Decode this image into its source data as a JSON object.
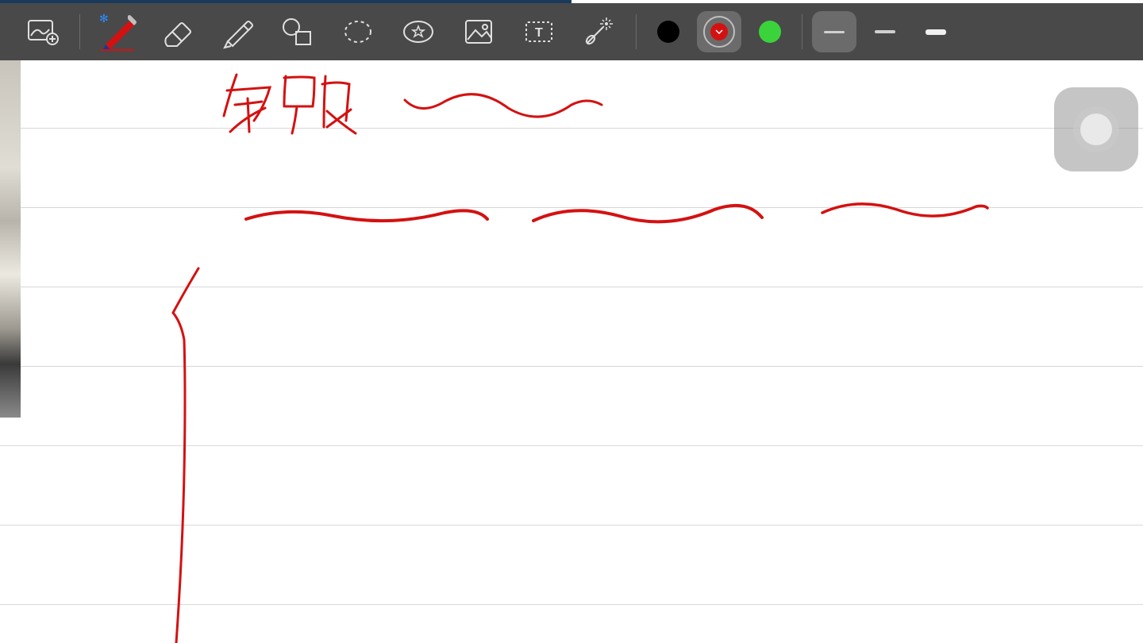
{
  "toolbar": {
    "tools": [
      {
        "name": "insert-image-icon"
      },
      {
        "name": "pen-icon",
        "active": true
      },
      {
        "name": "eraser-icon"
      },
      {
        "name": "highlighter-icon"
      },
      {
        "name": "shape-tool-icon"
      },
      {
        "name": "lasso-icon"
      },
      {
        "name": "favorite-tool-icon"
      },
      {
        "name": "image-icon"
      },
      {
        "name": "text-box-icon"
      },
      {
        "name": "laser-pointer-icon"
      }
    ],
    "colors": {
      "black": "#000000",
      "red": "#d41111",
      "green": "#3bd33b",
      "selected": "red"
    },
    "stroke_widths": {
      "thin": 3,
      "medium": 4,
      "thick": 6,
      "selected": "thin"
    }
  },
  "canvas": {
    "handwritten_text": "知识",
    "stroke_color": "#d41111",
    "paper": "ruled"
  },
  "progress": 0.5
}
